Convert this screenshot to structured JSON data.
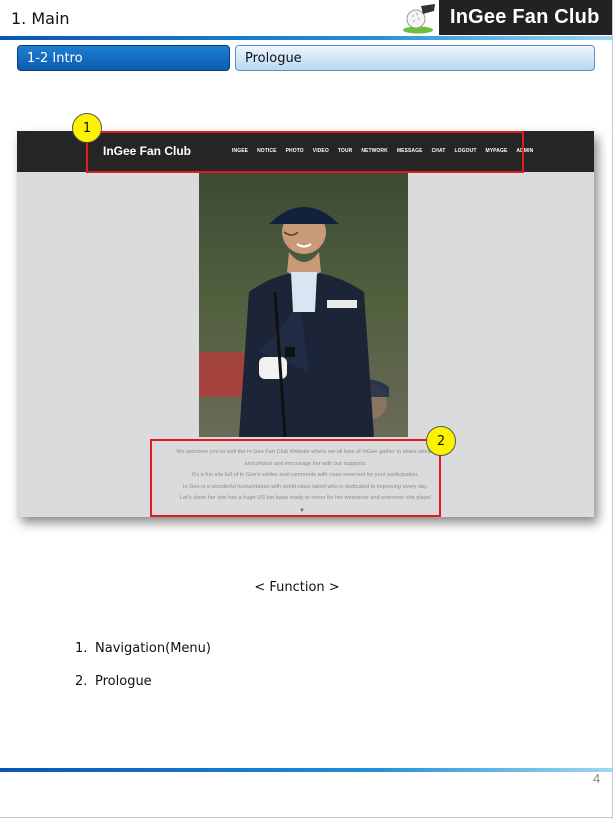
{
  "slide": {
    "title": "1. Main",
    "logo_text": "InGee Fan Club",
    "page_number": "4"
  },
  "tabs": [
    {
      "label": "1-2  Intro",
      "active": true
    },
    {
      "label": "Prologue",
      "active": false
    }
  ],
  "site": {
    "brand": "InGee Fan Club",
    "menu": [
      "INGEE",
      "NOTICE",
      "PHOTO",
      "VIDEO",
      "TOUR",
      "NETWORK",
      "MESSAGE",
      "CHAT",
      "LOGOUT",
      "MYPAGE",
      "ADMIN"
    ],
    "prologue_lines": [
      "We welcome you to visit the In Gee Fan Club Website where we all fans of InGee gather to share stories",
      "and photos and encourage her with our supports.",
      "It's a fun site full of In Gee's smiles and comments with room reserved for your participation.",
      "In Gee is a wonderful humanitarian with world-class talent who is dedicated to improving every day.",
      "Let's show her she has a huge US fan base ready to cheer for her whenever and wherever she plays!"
    ],
    "scroll_glyph": "▼"
  },
  "badges": [
    "1",
    "2"
  ],
  "function": {
    "heading": "< Function >",
    "items": [
      {
        "num": "1.",
        "label": "Navigation(Menu)"
      },
      {
        "num": "2.",
        "label": "Prologue"
      }
    ]
  },
  "colors": {
    "accent_blue": "#0a5bb0",
    "highlight_red": "#e01b1b",
    "badge_yellow": "#fff200",
    "nav_dark": "#252525"
  },
  "icons": {
    "logo_mark": "golf-ball-icon"
  }
}
